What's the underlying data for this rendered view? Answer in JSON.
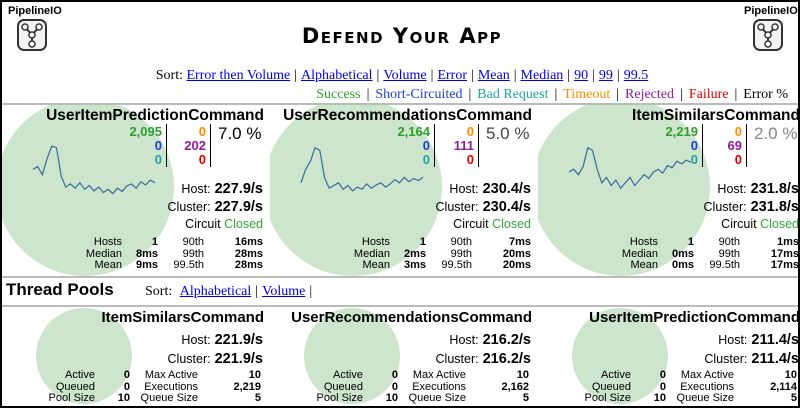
{
  "app": {
    "logo_text": "PipelineIO",
    "title": "Defend Your App"
  },
  "sort": {
    "label": "Sort:",
    "links": [
      "Error then Volume",
      "Alphabetical",
      "Volume",
      "Error",
      "Mean",
      "Median",
      "90",
      "99",
      "99.5"
    ]
  },
  "legend": [
    {
      "label": "Success",
      "color": "#2e9e2e"
    },
    {
      "label": "Short-Circuited",
      "color": "#1f3fd0"
    },
    {
      "label": "Bad Request",
      "color": "#1fa3a3"
    },
    {
      "label": "Timeout",
      "color": "#ff8c00"
    },
    {
      "label": "Rejected",
      "color": "#8b1c9e"
    },
    {
      "label": "Failure",
      "color": "#e00000"
    },
    {
      "label": "Error %",
      "color": "#000000"
    }
  ],
  "colors": {
    "success": "#2e9e2e",
    "short_circuited": "#1f3fd0",
    "bad_request": "#1fa3a3",
    "timeout": "#ff8c00",
    "rejected": "#8b1c9e",
    "failure": "#e00000",
    "bubble": "#a4cea4",
    "circuit_closed": "#36a336"
  },
  "commands": [
    {
      "name": "UserItemPredictionCommand",
      "success": "2,095",
      "short_circuited": "0",
      "bad_request": "0",
      "timeout": "0",
      "rejected": "202",
      "failure": "0",
      "error_pct": "7.0 %",
      "error_color": "#000000",
      "host_label": "Host:",
      "host_rate": "227.9/s",
      "cluster_label": "Cluster:",
      "cluster_rate": "227.9/s",
      "circuit_label": "Circuit",
      "circuit_state": "Closed",
      "stat_labels": [
        "Hosts",
        "Median",
        "Mean"
      ],
      "stat_values": [
        "1",
        "8ms",
        "9ms"
      ],
      "pct_labels": [
        "90th",
        "99th",
        "99.5th"
      ],
      "pct_values": [
        "16ms",
        "28ms",
        "28ms"
      ],
      "sparkline": [
        0.55,
        0.6,
        0.45,
        0.75,
        0.98,
        0.95,
        0.42,
        0.22,
        0.28,
        0.2,
        0.3,
        0.18,
        0.25,
        0.15,
        0.22,
        0.12,
        0.18,
        0.1,
        0.2,
        0.14,
        0.24,
        0.28,
        0.2,
        0.32,
        0.26,
        0.35,
        0.3
      ]
    },
    {
      "name": "UserRecommendationsCommand",
      "success": "2,164",
      "short_circuited": "0",
      "bad_request": "0",
      "timeout": "0",
      "rejected": "111",
      "failure": "0",
      "error_pct": "5.0 %",
      "error_color": "#444444",
      "host_label": "Host:",
      "host_rate": "230.4/s",
      "cluster_label": "Cluster:",
      "cluster_rate": "230.4/s",
      "circuit_label": "Circuit",
      "circuit_state": "Closed",
      "stat_labels": [
        "Hosts",
        "Median",
        "Mean"
      ],
      "stat_values": [
        "1",
        "2ms",
        "3ms"
      ],
      "pct_labels": [
        "90th",
        "99th",
        "99.5th"
      ],
      "pct_values": [
        "7ms",
        "20ms",
        "20ms"
      ],
      "sparkline": [
        0.3,
        0.55,
        0.7,
        0.95,
        0.9,
        0.4,
        0.2,
        0.25,
        0.3,
        0.18,
        0.25,
        0.15,
        0.22,
        0.18,
        0.28,
        0.2,
        0.26,
        0.3,
        0.22,
        0.28,
        0.36,
        0.3,
        0.4,
        0.32,
        0.38,
        0.34,
        0.4
      ]
    },
    {
      "name": "ItemSimilarsCommand",
      "success": "2,219",
      "short_circuited": "0",
      "bad_request": "0",
      "timeout": "0",
      "rejected": "69",
      "failure": "0",
      "error_pct": "2.0 %",
      "error_color": "#888888",
      "host_label": "Host:",
      "host_rate": "231.8/s",
      "cluster_label": "Cluster:",
      "cluster_rate": "231.8/s",
      "circuit_label": "Circuit",
      "circuit_state": "Closed",
      "stat_labels": [
        "Hosts",
        "Median",
        "Mean"
      ],
      "stat_values": [
        "1",
        "0ms",
        "0ms"
      ],
      "pct_labels": [
        "90th",
        "99th",
        "99.5th"
      ],
      "pct_values": [
        "1ms",
        "17ms",
        "17ms"
      ],
      "sparkline": [
        0.5,
        0.55,
        0.45,
        0.6,
        0.95,
        0.9,
        0.55,
        0.3,
        0.4,
        0.25,
        0.35,
        0.2,
        0.3,
        0.4,
        0.25,
        0.35,
        0.45,
        0.38,
        0.5,
        0.55,
        0.48,
        0.62,
        0.58,
        0.7,
        0.65,
        0.72,
        0.68
      ]
    }
  ],
  "thread_pools": {
    "title": "Thread Pools",
    "sort_label": "Sort:",
    "sort_links": [
      "Alphabetical",
      "Volume"
    ],
    "pools": [
      {
        "name": "ItemSimilarsCommand",
        "host_label": "Host:",
        "host_rate": "221.9/s",
        "cluster_label": "Cluster:",
        "cluster_rate": "221.9/s",
        "left_labels": [
          "Active",
          "Queued",
          "Pool Size"
        ],
        "left_values": [
          "0",
          "0",
          "10"
        ],
        "right_labels": [
          "Max Active",
          "Executions",
          "Queue Size"
        ],
        "right_values": [
          "10",
          "2,219",
          "5"
        ]
      },
      {
        "name": "UserRecommendationsCommand",
        "host_label": "Host:",
        "host_rate": "216.2/s",
        "cluster_label": "Cluster:",
        "cluster_rate": "216.2/s",
        "left_labels": [
          "Active",
          "Queued",
          "Pool Size"
        ],
        "left_values": [
          "0",
          "0",
          "10"
        ],
        "right_labels": [
          "Max Active",
          "Executions",
          "Queue Size"
        ],
        "right_values": [
          "10",
          "2,162",
          "5"
        ]
      },
      {
        "name": "UserItemPredictionCommand",
        "host_label": "Host:",
        "host_rate": "211.4/s",
        "cluster_label": "Cluster:",
        "cluster_rate": "211.4/s",
        "left_labels": [
          "Active",
          "Queued",
          "Pool Size"
        ],
        "left_values": [
          "0",
          "0",
          "10"
        ],
        "right_labels": [
          "Max Active",
          "Executions",
          "Queue Size"
        ],
        "right_values": [
          "10",
          "2,114",
          "5"
        ]
      }
    ]
  }
}
